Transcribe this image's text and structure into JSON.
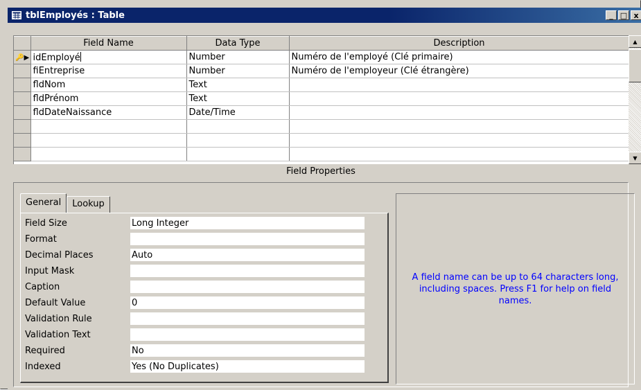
{
  "window": {
    "title": "tblEmployés : Table",
    "minimize_label": "_",
    "restore_label": "□",
    "close_label": "x"
  },
  "grid": {
    "columns": [
      "Field Name",
      "Data Type",
      "Description"
    ],
    "rows": [
      {
        "name": "idEmployé",
        "type": "Number",
        "desc": "Numéro de l'employé (Clé primaire)",
        "key": true,
        "selected": true
      },
      {
        "name": "fiEntreprise",
        "type": "Number",
        "desc": "Numéro de l'employeur (Clé étrangère)"
      },
      {
        "name": "fldNom",
        "type": "Text",
        "desc": ""
      },
      {
        "name": "fldPrénom",
        "type": "Text",
        "desc": ""
      },
      {
        "name": "fldDateNaissance",
        "type": "Date/Time",
        "desc": ""
      },
      {
        "name": "",
        "type": "",
        "desc": ""
      },
      {
        "name": "",
        "type": "",
        "desc": ""
      },
      {
        "name": "",
        "type": "",
        "desc": ""
      }
    ]
  },
  "field_properties_label": "Field Properties",
  "tabs": [
    "General",
    "Lookup"
  ],
  "properties": [
    {
      "label": "Field Size",
      "value": "Long Integer"
    },
    {
      "label": "Format",
      "value": ""
    },
    {
      "label": "Decimal Places",
      "value": "Auto"
    },
    {
      "label": "Input Mask",
      "value": ""
    },
    {
      "label": "Caption",
      "value": ""
    },
    {
      "label": "Default Value",
      "value": "0"
    },
    {
      "label": "Validation Rule",
      "value": ""
    },
    {
      "label": "Validation Text",
      "value": ""
    },
    {
      "label": "Required",
      "value": "No"
    },
    {
      "label": "Indexed",
      "value": "Yes (No Duplicates)"
    }
  ],
  "help_text": "A field name can be up to 64 characters long, including spaces.  Press F1 for help on field names.",
  "colors": {
    "title_bar": "#0a246a",
    "help_text": "#0000ff",
    "chrome": "#d4d0c8"
  }
}
